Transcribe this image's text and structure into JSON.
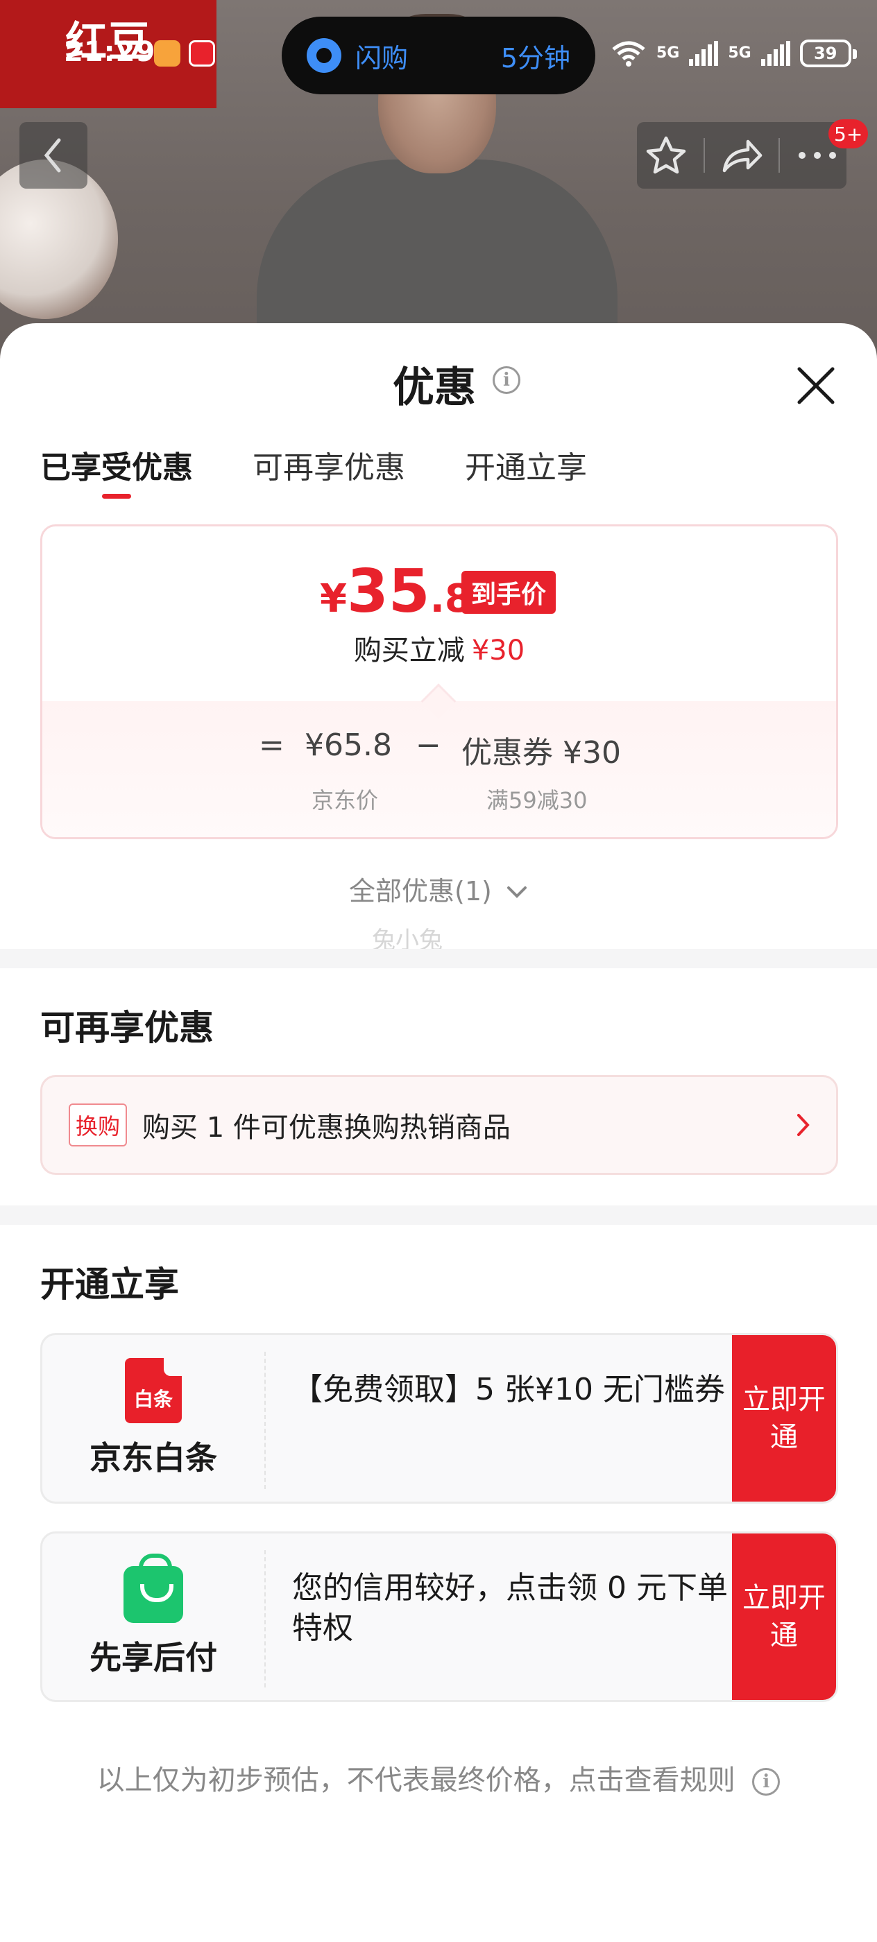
{
  "status_bar": {
    "time": "21:29",
    "flash_label": "闪购",
    "flash_time": "5分钟",
    "signal_1": "5G",
    "signal_2": "5G",
    "battery": "39"
  },
  "product": {
    "brand_logo": "红豆",
    "message_badge": "5+"
  },
  "sheet": {
    "title": "优惠",
    "tabs": [
      {
        "label": "已享受优惠",
        "active": true
      },
      {
        "label": "可再享优惠",
        "active": false
      },
      {
        "label": "开通立享",
        "active": false
      }
    ],
    "price_card": {
      "currency": "¥",
      "price_int": "35",
      "price_dec": ".8",
      "price_tag": "到手价",
      "instant_cut_label": "购买立减",
      "instant_cut_amount": "¥30",
      "formula_eq": "=",
      "jd_price": "¥65.8",
      "minus": "−",
      "coupon": "优惠券 ¥30",
      "jd_price_label": "京东价",
      "coupon_rule": "满59减30"
    },
    "all_offers": "全部优惠(1)",
    "watermark": "兔小兔",
    "extra_section": {
      "title": "可再享优惠",
      "swap_tag": "换购",
      "swap_text": "购买 1 件可优惠换购热销商品"
    },
    "open_section": {
      "title": "开通立享",
      "services": [
        {
          "icon_text": "白条",
          "name": "京东白条",
          "desc": "【免费领取】5 张¥10 无门槛券",
          "cta": "立即开通"
        },
        {
          "name": "先享后付",
          "desc": "您的信用较好，点击领 0 元下单特权",
          "cta": "立即开通"
        }
      ]
    },
    "footer_note": "以上仅为初步预估，不代表最终价格，点击查看规则"
  },
  "colors": {
    "accent_red": "#e8222c",
    "green": "#1cc56e",
    "flash_blue": "#3e8ef7"
  }
}
